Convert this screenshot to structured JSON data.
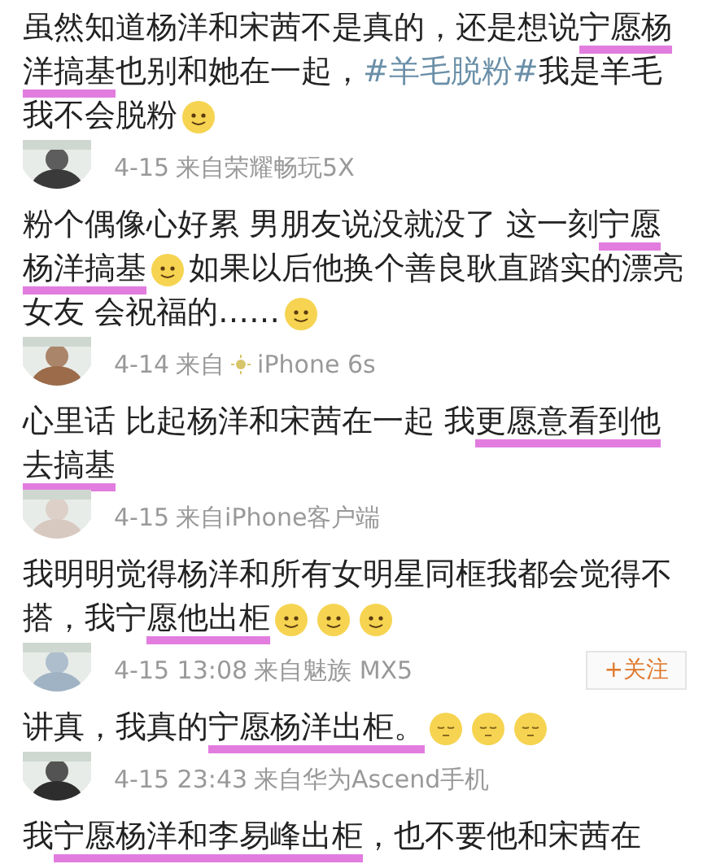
{
  "comments": [
    {
      "segments": [
        {
          "kind": "plain",
          "text": "虽然知道杨洋和宋茜不是真的，还是想说"
        },
        {
          "kind": "highlight",
          "text": "宁愿杨洋搞基"
        },
        {
          "kind": "plain",
          "text": "也别和她在一起，"
        },
        {
          "kind": "hashtag",
          "text": "#羊毛脱粉#"
        },
        {
          "kind": "plain",
          "text": "我是羊毛我不会脱粉"
        },
        {
          "kind": "smile"
        }
      ],
      "date": "4-15",
      "source": "来自荣耀畅玩5X"
    },
    {
      "segments": [
        {
          "kind": "plain",
          "text": "粉个偶像心好累 男朋友说没就没了 这一刻"
        },
        {
          "kind": "highlight",
          "text": "宁愿杨洋搞基"
        },
        {
          "kind": "smile"
        },
        {
          "kind": "plain",
          "text": "如果以后他换个善良耿直踏实的漂亮女友 会祝福的……"
        },
        {
          "kind": "smile"
        }
      ],
      "date": "4-14",
      "source": "来自",
      "device_icon": true,
      "device": "iPhone 6s"
    },
    {
      "segments": [
        {
          "kind": "plain",
          "text": "心里话 比起杨洋和宋茜在一起 我"
        },
        {
          "kind": "highlight",
          "text": "更愿意看到他去搞基"
        }
      ],
      "date": "4-15",
      "source": "来自iPhone客户端"
    },
    {
      "segments": [
        {
          "kind": "plain",
          "text": "我明明觉得杨洋和所有女明星同框我都会觉得不搭，我宁"
        },
        {
          "kind": "highlight",
          "text": "愿他出柜"
        },
        {
          "kind": "smile"
        },
        {
          "kind": "smile"
        },
        {
          "kind": "smile"
        }
      ],
      "date": "4-15 13:08",
      "source": "来自魅族 MX5",
      "follow": "+关注"
    },
    {
      "segments": [
        {
          "kind": "plain",
          "text": "讲真，我真的"
        },
        {
          "kind": "highlight",
          "text": "宁愿杨洋出柜。"
        },
        {
          "kind": "calm"
        },
        {
          "kind": "calm"
        },
        {
          "kind": "calm"
        }
      ],
      "date": "4-15 23:43",
      "source": "来自华为Ascend手机"
    },
    {
      "segments": [
        {
          "kind": "plain",
          "text": "我"
        },
        {
          "kind": "highlight",
          "text": "宁愿杨洋和李易峰出柜"
        },
        {
          "kind": "plain",
          "text": "，也不要他和宋茜在"
        }
      ]
    }
  ]
}
